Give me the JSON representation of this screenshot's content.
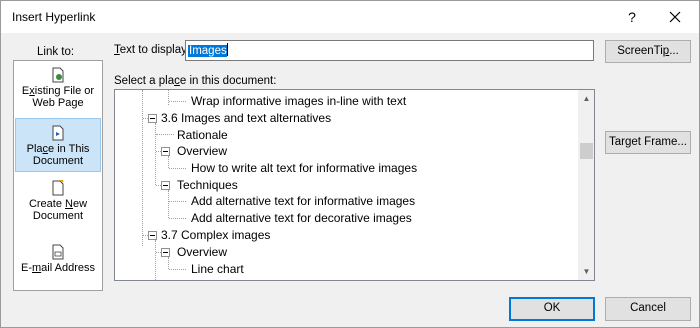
{
  "dialog": {
    "title": "Insert Hyperlink",
    "help_glyph": "?",
    "close_icon": "close-icon"
  },
  "linkto": {
    "label": "Link to:",
    "items": [
      {
        "pre": "E",
        "acc": "x",
        "post": "isting File or",
        "line2": "Web Page",
        "icon": "file-globe-icon",
        "selected": false
      },
      {
        "pre": "Pla",
        "acc": "c",
        "post": "e in This",
        "line2": "Document",
        "icon": "document-place-icon",
        "selected": true
      },
      {
        "pre": "Create ",
        "acc": "N",
        "post": "ew",
        "line2": "Document",
        "icon": "new-document-icon",
        "selected": false
      },
      {
        "pre": "E-",
        "acc": "m",
        "post": "ail Address",
        "line2": "",
        "icon": "email-icon",
        "selected": false
      }
    ]
  },
  "display": {
    "label_acc": "T",
    "label_rest": "ext to display:",
    "value": "Images"
  },
  "place": {
    "label_pre": "Select a pla",
    "label_acc": "c",
    "label_post": "e in this document:"
  },
  "tree": {
    "items": [
      {
        "text": "Wrap informative images in-line with text"
      },
      {
        "text": "3.6 Images and text alternatives"
      },
      {
        "text": "Rationale"
      },
      {
        "text": "Overview"
      },
      {
        "text": "How to write alt text for informative images"
      },
      {
        "text": "Techniques"
      },
      {
        "text": "Add alternative text for informative images"
      },
      {
        "text": "Add alternative text for decorative images"
      },
      {
        "text": "3.7 Complex images"
      },
      {
        "text": "Overview"
      },
      {
        "text": "Line chart"
      }
    ]
  },
  "buttons": {
    "screentip": {
      "pre": "ScreenTi",
      "acc": "p",
      "post": "..."
    },
    "target": {
      "pre": "Tar",
      "acc": "g",
      "post": "et Frame..."
    },
    "ok": "OK",
    "cancel": "Cancel"
  },
  "colors": {
    "selected_bg": "#cce4f7",
    "accent": "#0078d7"
  }
}
